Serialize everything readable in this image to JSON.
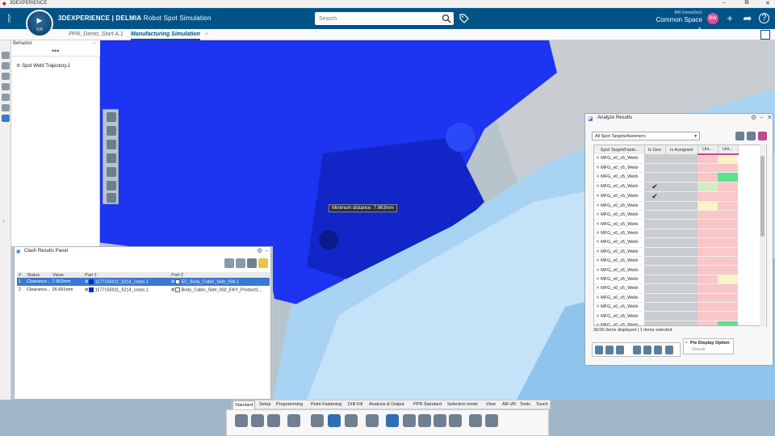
{
  "window": {
    "title": "3DEXPERIENCE",
    "min": "–",
    "max": "⧉",
    "close": "✕"
  },
  "header": {
    "brand_bold": "3DEXPERIENCE | DELMIA",
    "brand_app": "Robot Spot Simulation",
    "compass_label": "V,R",
    "search_placeholder": "Search",
    "user_name": "BW  DemoDev1",
    "space": "Common Space",
    "avatar_initials": "BW"
  },
  "tabs": [
    {
      "label": "PPR_Demo_Start A.1"
    },
    {
      "label": "Manufacturing Simulation"
    }
  ],
  "tree": {
    "title": "Behavior",
    "node": "Spot Weld Trajectory.1"
  },
  "tooltip": "Minimum distance: 7.963mm",
  "clash": {
    "title": "Clash Results Panel",
    "columns": [
      "#",
      "Status",
      "Value",
      "Part 1",
      "Part 2"
    ],
    "rows": [
      {
        "n": "1",
        "status": "Clearance...",
        "value": "7.963mm",
        "part1": "1177150011_6214_corps.1",
        "part2": "EC_Body_Cabin_Side_006.1"
      },
      {
        "n": "2",
        "status": "Clearance...",
        "value": "26.651mm",
        "part1": "1177150011_6214_corps.1",
        "part2": "Body_Cabin_Side_002_EKY_Product1..."
      }
    ]
  },
  "analyze": {
    "title": "Analyze Results",
    "filter": "All Spot Targets/fasteners",
    "columns": [
      "Spot Target/Faste...",
      "Is Geo",
      "Is Assigned",
      "Uni...",
      "Uni..."
    ],
    "rows": [
      {
        "name": "MFG_v0_v5_Weld-",
        "geo": ""
      },
      {
        "name": "MFG_v0_v5_Weld-",
        "geo": ""
      },
      {
        "name": "MFG_v0_v5_Weld-",
        "geo": ""
      },
      {
        "name": "MFG_v0_v5_Weld-",
        "geo": "✔"
      },
      {
        "name": "MFG_v0_v5_Weld-",
        "geo": "✔"
      },
      {
        "name": "MFG_v0_v5_Weld-",
        "geo": ""
      },
      {
        "name": "MFG_v0_v5_Weld-",
        "geo": ""
      },
      {
        "name": "MFG_v0_v5_Weld-",
        "geo": ""
      },
      {
        "name": "MFG_v0_v5_Weld-",
        "geo": ""
      },
      {
        "name": "MFG_v0_v5_Weld-",
        "geo": ""
      },
      {
        "name": "MFG_v0_v5_Weld-",
        "geo": ""
      },
      {
        "name": "MFG_v0_v5_Weld-",
        "geo": ""
      },
      {
        "name": "MFG_v0_v5_Weld-",
        "geo": ""
      },
      {
        "name": "MFG_v0_v5_Weld-",
        "geo": ""
      },
      {
        "name": "MFG_v0_v5_Weld-",
        "geo": ""
      },
      {
        "name": "MFG_v0_v5_Weld-",
        "geo": ""
      },
      {
        "name": "MFG_v0_v5_Weld-",
        "geo": ""
      },
      {
        "name": "MFG_v0_v5_Weld-",
        "geo": ""
      },
      {
        "name": "MFG_v0_v5_Weld-",
        "geo": ""
      }
    ],
    "status": "36/36 items displayed | 1 items selected",
    "pie_title": "Pie Display Option",
    "pie_sub": "Overall"
  },
  "bottom_tabs": [
    "Standard",
    "Setup",
    "Programming",
    "Point Fastening",
    "Drill Fill",
    "Analysis & Output",
    "PPR Standard",
    "Selection mode",
    "View",
    "AR-VR",
    "Tools",
    "Touch"
  ]
}
